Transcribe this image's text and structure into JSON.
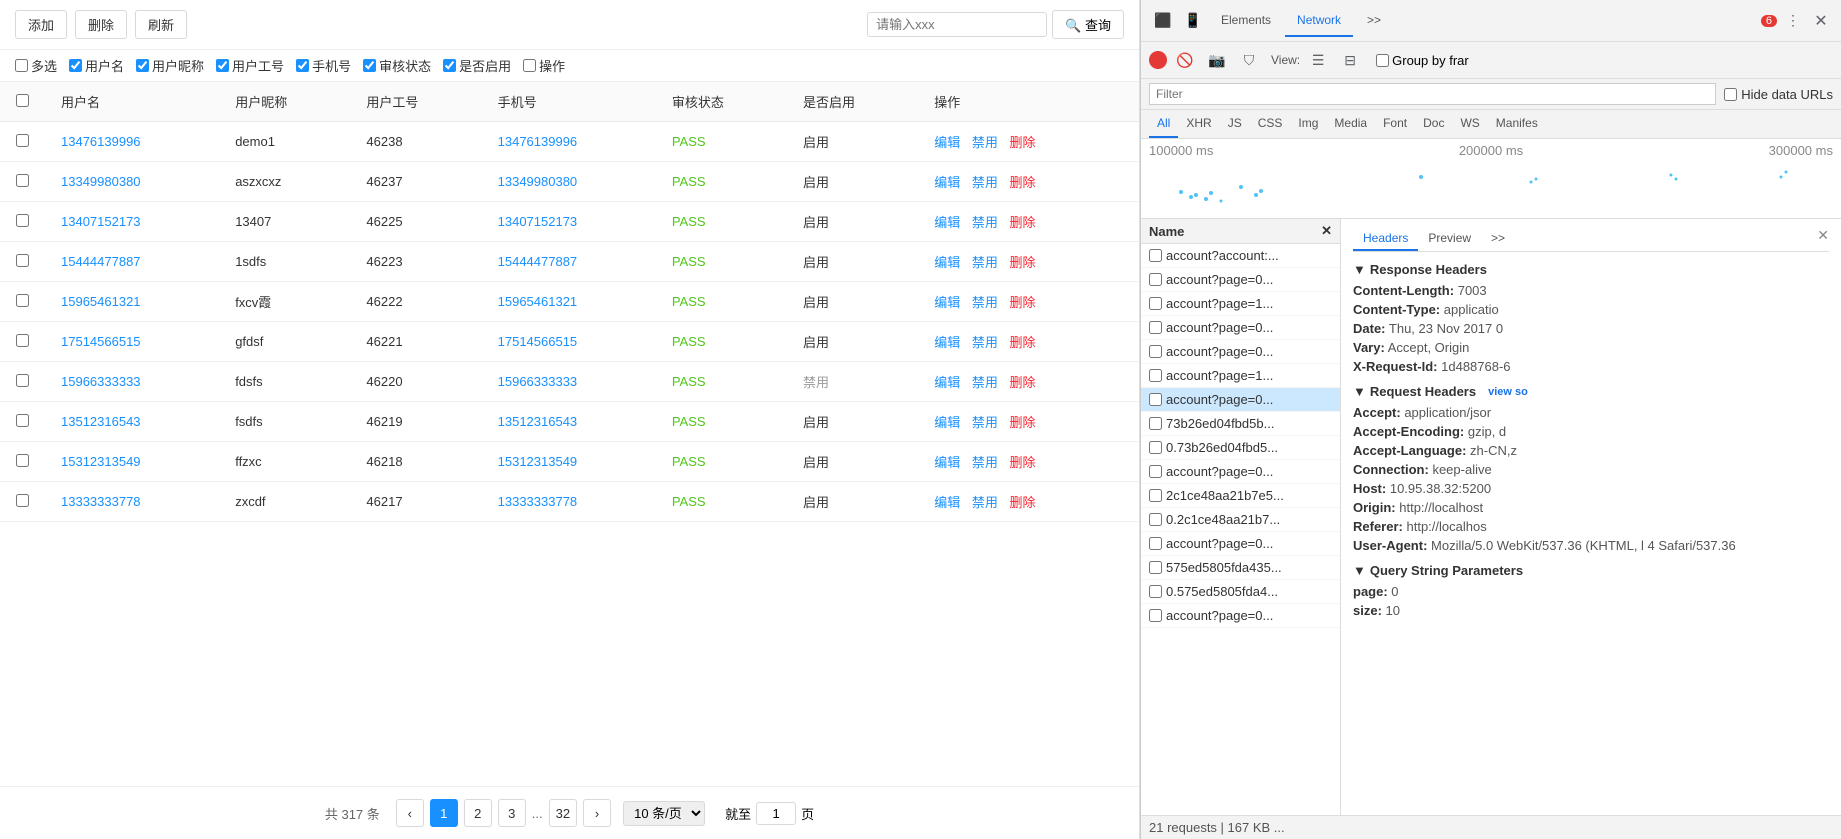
{
  "toolbar": {
    "add_label": "添加",
    "delete_label": "删除",
    "refresh_label": "刷新",
    "search_placeholder": "请输入xxx",
    "search_btn_label": "查询"
  },
  "filters": [
    {
      "id": "multi",
      "label": "多选",
      "checked": false
    },
    {
      "id": "username",
      "label": "用户名",
      "checked": true
    },
    {
      "id": "nickname",
      "label": "用户昵称",
      "checked": true
    },
    {
      "id": "userid",
      "label": "用户工号",
      "checked": true
    },
    {
      "id": "phone",
      "label": "手机号",
      "checked": true
    },
    {
      "id": "audit",
      "label": "审核状态",
      "checked": true
    },
    {
      "id": "enabled",
      "label": "是否启用",
      "checked": true
    },
    {
      "id": "action",
      "label": "操作",
      "checked": false
    }
  ],
  "table": {
    "columns": [
      "用户名",
      "用户昵称",
      "用户工号",
      "手机号",
      "审核状态",
      "是否启用",
      "操作"
    ],
    "rows": [
      {
        "username": "13476139996",
        "nickname": "demo1",
        "userid": "46238",
        "phone": "13476139996",
        "audit": "PASS",
        "enabled": "启用"
      },
      {
        "username": "13349980380",
        "nickname": "aszxcxz",
        "userid": "46237",
        "phone": "13349980380",
        "audit": "PASS",
        "enabled": "启用"
      },
      {
        "username": "13407152173",
        "nickname": "13407",
        "userid": "46225",
        "phone": "13407152173",
        "audit": "PASS",
        "enabled": "启用"
      },
      {
        "username": "15444477887",
        "nickname": "1sdfs",
        "userid": "46223",
        "phone": "15444477887",
        "audit": "PASS",
        "enabled": "启用"
      },
      {
        "username": "15965461321",
        "nickname": "fxcv霞",
        "userid": "46222",
        "phone": "15965461321",
        "audit": "PASS",
        "enabled": "启用"
      },
      {
        "username": "17514566515",
        "nickname": "gfdsf",
        "userid": "46221",
        "phone": "17514566515",
        "audit": "PASS",
        "enabled": "启用"
      },
      {
        "username": "15966333333",
        "nickname": "fdsfs",
        "userid": "46220",
        "phone": "15966333333",
        "audit": "PASS",
        "enabled": "禁用"
      },
      {
        "username": "13512316543",
        "nickname": "fsdfs",
        "userid": "46219",
        "phone": "13512316543",
        "audit": "PASS",
        "enabled": "启用"
      },
      {
        "username": "15312313549",
        "nickname": "ffzxc",
        "userid": "46218",
        "phone": "15312313549",
        "audit": "PASS",
        "enabled": "启用"
      },
      {
        "username": "13333333778",
        "nickname": "zxcdf",
        "userid": "46217",
        "phone": "13333333778",
        "audit": "PASS",
        "enabled": "启用"
      }
    ],
    "actions": [
      "编辑",
      "禁用",
      "删除"
    ]
  },
  "pagination": {
    "total_text": "共 317 条",
    "pages": [
      "1",
      "2",
      "3",
      "...",
      "32"
    ],
    "current": "1",
    "page_size": "10 条/页",
    "goto_label": "就至",
    "page_label": "页"
  },
  "devtools": {
    "tabs": [
      "Elements",
      "Network",
      ">>"
    ],
    "active_tab": "Network",
    "error_count": "6",
    "icons": {
      "record": "●",
      "clear": "🚫",
      "camera": "📷",
      "filter": "⛉",
      "more": "⋮",
      "close": "✕"
    },
    "network_toolbar": {
      "view_label": "View:",
      "group_by_label": "Group by frar",
      "filter_placeholder": "Filter",
      "hide_data_urls_label": "Hide data URLs"
    },
    "type_tabs": [
      "All",
      "XHR",
      "JS",
      "CSS",
      "Img",
      "Media",
      "Font",
      "Doc",
      "WS",
      "Manifes"
    ],
    "active_type": "All",
    "timeline": {
      "labels": [
        "100000 ms",
        "200000 ms",
        "300000 ms"
      ]
    },
    "name_list": {
      "header": "Name",
      "items": [
        {
          "name": "account?account:...",
          "selected": false
        },
        {
          "name": "account?page=0...",
          "selected": false
        },
        {
          "name": "account?page=1...",
          "selected": false
        },
        {
          "name": "account?page=0...",
          "selected": false
        },
        {
          "name": "account?page=0...",
          "selected": false
        },
        {
          "name": "account?page=1...",
          "selected": false
        },
        {
          "name": "account?page=0...",
          "selected": true
        },
        {
          "name": "73b26ed04fbd5b...",
          "selected": false
        },
        {
          "name": "0.73b26ed04fbd5...",
          "selected": false
        },
        {
          "name": "account?page=0...",
          "selected": false
        },
        {
          "name": "2c1ce48aa21b7e5...",
          "selected": false
        },
        {
          "name": "0.2c1ce48aa21b7...",
          "selected": false
        },
        {
          "name": "account?page=0...",
          "selected": false
        },
        {
          "name": "575ed5805fda435...",
          "selected": false
        },
        {
          "name": "0.575ed5805fda4...",
          "selected": false
        },
        {
          "name": "account?page=0...",
          "selected": false
        }
      ]
    },
    "detail": {
      "tabs": [
        "Headers",
        "Preview",
        ">>"
      ],
      "active_tab": "Headers",
      "response_headers_label": "Response Headers",
      "response_headers": [
        {
          "key": "Content-Length:",
          "value": "7003"
        },
        {
          "key": "Content-Type:",
          "value": "applicatio"
        },
        {
          "key": "Date:",
          "value": "Thu, 23 Nov 2017 0"
        },
        {
          "key": "Vary:",
          "value": "Accept, Origin"
        },
        {
          "key": "X-Request-Id:",
          "value": "1d488768-6"
        }
      ],
      "request_headers_label": "Request Headers",
      "view_source_label": "view so",
      "request_headers": [
        {
          "key": "Accept:",
          "value": "application/jsor"
        },
        {
          "key": "Accept-Encoding:",
          "value": "gzip, d"
        },
        {
          "key": "Accept-Language:",
          "value": "zh-CN,z"
        },
        {
          "key": "Connection:",
          "value": "keep-alive"
        },
        {
          "key": "Host:",
          "value": "10.95.38.32:5200"
        },
        {
          "key": "Origin:",
          "value": "http://localhost"
        },
        {
          "key": "Referer:",
          "value": "http://localhos"
        },
        {
          "key": "User-Agent:",
          "value": "Mozilla/5.0 WebKit/537.36 (KHTML, l 4 Safari/537.36"
        }
      ],
      "query_string_label": "Query String Parameters",
      "query_params": [
        {
          "key": "page:",
          "value": "0"
        },
        {
          "key": "size:",
          "value": "10"
        }
      ]
    },
    "status_bar": "21 requests | 167 KB ..."
  }
}
